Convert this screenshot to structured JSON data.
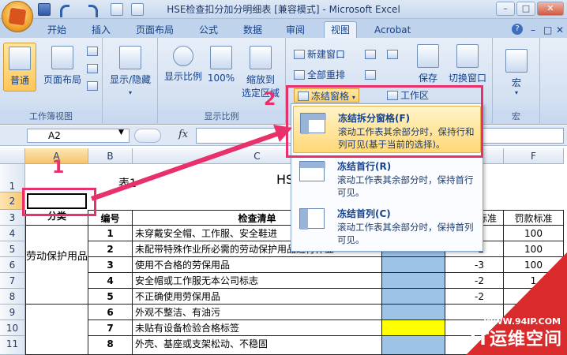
{
  "window": {
    "title": "HSE检查扣分加分明细表  [兼容模式] - Microsoft Excel",
    "help_icon": "?",
    "minimize": "–",
    "maximize": "□",
    "close": "✕"
  },
  "tabs": [
    "开始",
    "插入",
    "页面布局",
    "公式",
    "数据",
    "审阅",
    "视图",
    "Acrobat"
  ],
  "active_tab": "视图",
  "ribbon": {
    "workbook_views": {
      "label": "工作簿视图",
      "normal": "普通",
      "page_layout": "页面布局"
    },
    "show_hide": "显示/隐藏",
    "zoom_group": {
      "label": "显示比例",
      "zoom": "显示比例",
      "hundred": "100%",
      "zoom_to_selection_line1": "缩放到",
      "zoom_to_selection_line2": "选定区域"
    },
    "window_group": {
      "new_window": "新建窗口",
      "arrange_all": "全部重排",
      "freeze_panes": "冻结窗格",
      "workspace": "工作区",
      "save": "保存",
      "switch_window": "切换窗口"
    },
    "macro_group": {
      "label": "宏",
      "macro": "宏"
    }
  },
  "formula_bar": {
    "name_box": "A2",
    "fx": "fx",
    "value": ""
  },
  "dropdown": {
    "items": [
      {
        "title": "冻结拆分窗格(F)",
        "desc": "滚动工作表其余部分时，保持行和列可见(基于当前的选择)。"
      },
      {
        "title": "冻结首行(R)",
        "desc": "滚动工作表其余部分时，保持首行可见。"
      },
      {
        "title": "冻结首列(C)",
        "desc": "滚动工作表其余部分时，保持首列可见。"
      }
    ]
  },
  "sheet": {
    "columns": [
      "A",
      "B",
      "C",
      "D",
      "E",
      "F"
    ],
    "row_numbers": [
      "1",
      "2",
      "3",
      "4",
      "5",
      "6",
      "7",
      "8",
      "9",
      "10",
      "11"
    ],
    "title_prefix": "表1",
    "title_visible": "HS",
    "headers": {
      "category": "分类",
      "number": "编号",
      "checklist": "检查清单",
      "deduct": "标准",
      "penalty": "罚款标准"
    },
    "category_group": "劳动保护用品",
    "rows": [
      {
        "no": "1",
        "item": "未穿戴安全帽、工作服、安全鞋进",
        "deduct": "",
        "penalty": "100"
      },
      {
        "no": "2",
        "item": "未配带特殊作业所必需的劳动保护用品进行作业",
        "deduct": "-2",
        "penalty": "100"
      },
      {
        "no": "3",
        "item": "使用不合格的劳保用品",
        "deduct": "-3",
        "penalty": "100"
      },
      {
        "no": "4",
        "item": "安全帽或工作服无本公司标志",
        "deduct": "-2",
        "penalty": "1"
      },
      {
        "no": "5",
        "item": "不正确使用劳保用品",
        "deduct": "-2",
        "penalty": ""
      },
      {
        "no": "6",
        "item": "外观不整洁、有油污",
        "deduct": "",
        "penalty": ""
      },
      {
        "no": "7",
        "item": "未贴有设备检验合格标签",
        "deduct": "",
        "penalty": ""
      },
      {
        "no": "8",
        "item": "外壳、基座或支架松动、不稳固",
        "deduct": "",
        "penalty": ""
      }
    ]
  },
  "annotations": {
    "step1": "1",
    "step2": "2"
  },
  "watermark": {
    "url": "WWW.94IP.COM",
    "name": "IT运维空间"
  },
  "colors": {
    "accent_red": "#e8306a",
    "cell_blue": "#9dc3e6",
    "cell_yellow": "#ffff00",
    "ribbon_blue": "#15428b"
  }
}
